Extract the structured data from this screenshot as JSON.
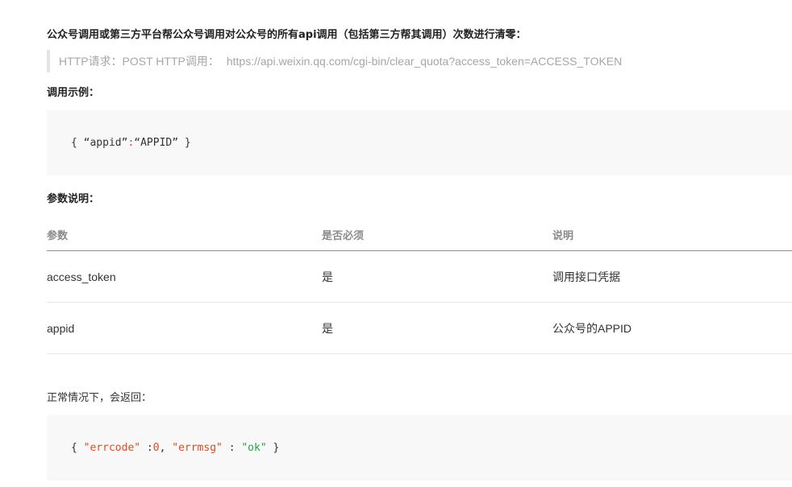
{
  "title": "公众号调用或第三方平台帮公众号调用对公众号的所有api调用（包括第三方帮其调用）次数进行清零：",
  "request": {
    "label": "HTTP请求：POST HTTP调用：",
    "url": "https://api.weixin.qq.com/cgi-bin/clear_quota?access_token=ACCESS_TOKEN"
  },
  "example": {
    "heading": "调用示例：",
    "code": {
      "open": "{ ",
      "key": "“appid”",
      "colon": ":",
      "value": "“APPID”",
      "close": " }"
    }
  },
  "params": {
    "heading": "参数说明：",
    "columns": [
      "参数",
      "是否必须",
      "说明"
    ],
    "rows": [
      [
        "access_token",
        "是",
        "调用接口凭据"
      ],
      [
        "appid",
        "是",
        "公众号的APPID"
      ]
    ]
  },
  "response": {
    "intro": "正常情况下，会返回：",
    "code": {
      "open": "{ ",
      "k1": "\"errcode\"",
      "sep1": " :",
      "v1": "0",
      "comma": ", ",
      "k2": "\"errmsg\"",
      "sep2": " : ",
      "v2": "\"ok\"",
      "close": " }"
    }
  },
  "colors": {
    "string": "#dd4a2a",
    "ok_value": "#22a34a",
    "quote_text": "#a6a6a6",
    "code_bg": "#f8f8f8"
  }
}
